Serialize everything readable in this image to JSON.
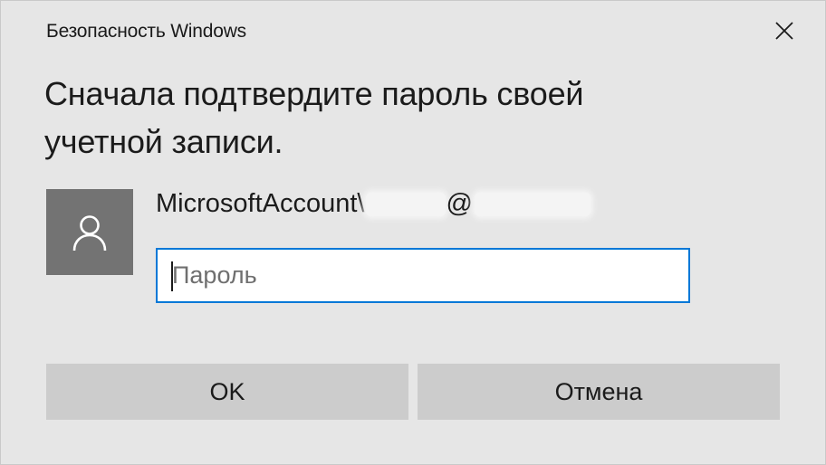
{
  "window": {
    "title": "Безопасность Windows",
    "close_icon": "close-icon"
  },
  "dialog": {
    "heading": "Сначала подтвердите пароль своей учетной записи.",
    "account": {
      "avatar_icon": "user-icon",
      "name_prefix": "MicrosoftAccount\\",
      "name_at": "@"
    },
    "password": {
      "value": "",
      "placeholder": "Пароль"
    },
    "buttons": {
      "ok_label": "OK",
      "cancel_label": "Отмена"
    }
  },
  "colors": {
    "background": "#e6e6e6",
    "accent": "#0078d7",
    "button": "#cccccc",
    "avatar": "#737373"
  }
}
